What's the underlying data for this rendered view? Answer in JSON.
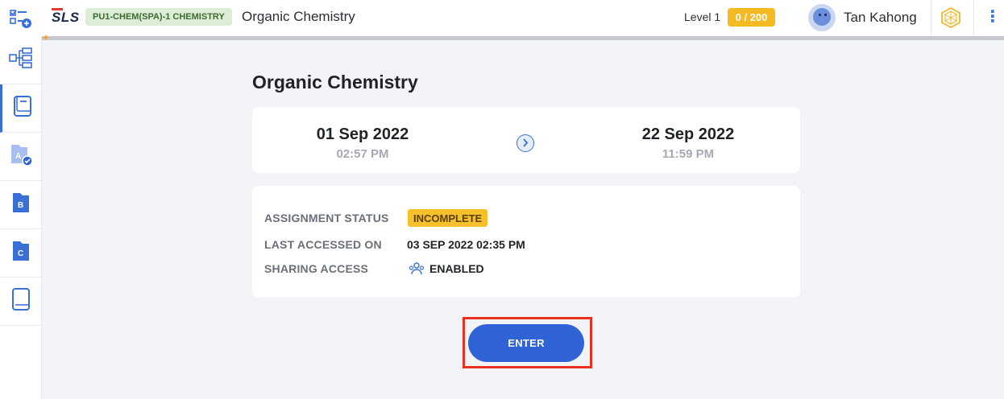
{
  "topbar": {
    "logo": "SLS",
    "course_badge": "PU1-CHEM(SPA)-1 CHEMISTRY",
    "title": "Organic Chemistry",
    "level_label": "Level 1",
    "level_points": "0 / 200",
    "user_name": "Tan Kahong"
  },
  "sidebar": {
    "items": [
      {
        "icon": "tree-structure-icon"
      },
      {
        "icon": "notebook-icon"
      },
      {
        "icon": "folder-a-icon",
        "label": "A"
      },
      {
        "icon": "folder-b-icon",
        "label": "B"
      },
      {
        "icon": "folder-c-icon",
        "label": "C"
      },
      {
        "icon": "book-icon"
      }
    ]
  },
  "main": {
    "title": "Organic Chemistry",
    "start": {
      "date": "01 Sep 2022",
      "time": "02:57 PM"
    },
    "end": {
      "date": "22 Sep 2022",
      "time": "11:59 PM"
    },
    "info": {
      "status_label": "ASSIGNMENT STATUS",
      "status_value": "INCOMPLETE",
      "accessed_label": "LAST ACCESSED ON",
      "accessed_value": "03 SEP 2022 02:35 PM",
      "sharing_label": "SHARING ACCESS",
      "sharing_value": "ENABLED"
    },
    "enter_label": "ENTER"
  },
  "colors": {
    "accent": "#2f63d6",
    "status": "#f6c02b",
    "highlight": "#e8321f"
  }
}
